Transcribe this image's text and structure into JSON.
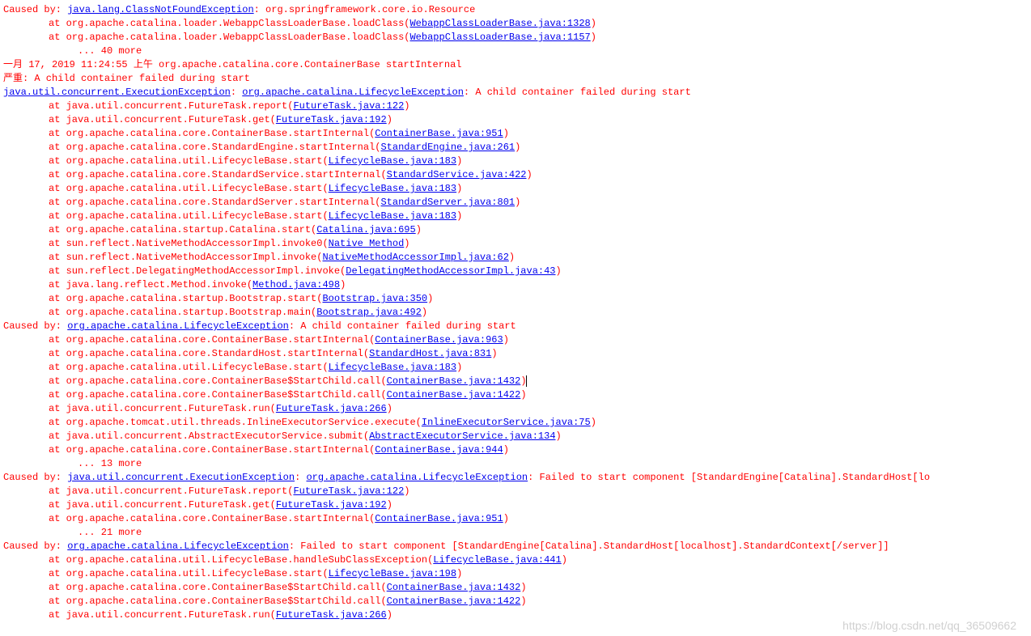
{
  "watermark": "https://blog.csdn.net/qq_36509662",
  "lines": [
    {
      "parts": [
        {
          "t": "Caused by: ",
          "c": "red"
        },
        {
          "t": "java.lang.ClassNotFoundException",
          "c": "blue"
        },
        {
          "t": ": org.springframework.core.io.Resource",
          "c": "red"
        }
      ]
    },
    {
      "indent": "at",
      "parts": [
        {
          "t": "at org.apache.catalina.loader.WebappClassLoaderBase.loadClass(",
          "c": "red"
        },
        {
          "t": "WebappClassLoaderBase.java:1328",
          "c": "blue"
        },
        {
          "t": ")",
          "c": "red"
        }
      ]
    },
    {
      "indent": "at",
      "parts": [
        {
          "t": "at org.apache.catalina.loader.WebappClassLoaderBase.loadClass(",
          "c": "red"
        },
        {
          "t": "WebappClassLoaderBase.java:1157",
          "c": "blue"
        },
        {
          "t": ")",
          "c": "red"
        }
      ]
    },
    {
      "indent": "more",
      "parts": [
        {
          "t": "... 40 more",
          "c": "red"
        }
      ]
    },
    {
      "parts": [
        {
          "t": " ",
          "c": "black"
        }
      ]
    },
    {
      "parts": [
        {
          "t": "一月 17, 2019 11:24:55 上午 org.apache.catalina.core.ContainerBase startInternal",
          "c": "red"
        }
      ]
    },
    {
      "parts": [
        {
          "t": "严重: A child container failed during start",
          "c": "red"
        }
      ]
    },
    {
      "parts": [
        {
          "t": "java.util.concurrent.ExecutionException",
          "c": "blue"
        },
        {
          "t": ": ",
          "c": "red"
        },
        {
          "t": "org.apache.catalina.LifecycleException",
          "c": "blue"
        },
        {
          "t": ": A child container failed during start",
          "c": "red"
        }
      ]
    },
    {
      "indent": "at",
      "parts": [
        {
          "t": "at java.util.concurrent.FutureTask.report(",
          "c": "red"
        },
        {
          "t": "FutureTask.java:122",
          "c": "blue"
        },
        {
          "t": ")",
          "c": "red"
        }
      ]
    },
    {
      "indent": "at",
      "parts": [
        {
          "t": "at java.util.concurrent.FutureTask.get(",
          "c": "red"
        },
        {
          "t": "FutureTask.java:192",
          "c": "blue"
        },
        {
          "t": ")",
          "c": "red"
        }
      ]
    },
    {
      "indent": "at",
      "parts": [
        {
          "t": "at org.apache.catalina.core.ContainerBase.startInternal(",
          "c": "red"
        },
        {
          "t": "ContainerBase.java:951",
          "c": "blue"
        },
        {
          "t": ")",
          "c": "red"
        }
      ]
    },
    {
      "indent": "at",
      "parts": [
        {
          "t": "at org.apache.catalina.core.StandardEngine.startInternal(",
          "c": "red"
        },
        {
          "t": "StandardEngine.java:261",
          "c": "blue"
        },
        {
          "t": ")",
          "c": "red"
        }
      ]
    },
    {
      "indent": "at",
      "parts": [
        {
          "t": "at org.apache.catalina.util.LifecycleBase.start(",
          "c": "red"
        },
        {
          "t": "LifecycleBase.java:183",
          "c": "blue"
        },
        {
          "t": ")",
          "c": "red"
        }
      ]
    },
    {
      "indent": "at",
      "parts": [
        {
          "t": "at org.apache.catalina.core.StandardService.startInternal(",
          "c": "red"
        },
        {
          "t": "StandardService.java:422",
          "c": "blue"
        },
        {
          "t": ")",
          "c": "red"
        }
      ]
    },
    {
      "indent": "at",
      "parts": [
        {
          "t": "at org.apache.catalina.util.LifecycleBase.start(",
          "c": "red"
        },
        {
          "t": "LifecycleBase.java:183",
          "c": "blue"
        },
        {
          "t": ")",
          "c": "red"
        }
      ]
    },
    {
      "indent": "at",
      "parts": [
        {
          "t": "at org.apache.catalina.core.StandardServer.startInternal(",
          "c": "red"
        },
        {
          "t": "StandardServer.java:801",
          "c": "blue"
        },
        {
          "t": ")",
          "c": "red"
        }
      ]
    },
    {
      "indent": "at",
      "parts": [
        {
          "t": "at org.apache.catalina.util.LifecycleBase.start(",
          "c": "red"
        },
        {
          "t": "LifecycleBase.java:183",
          "c": "blue"
        },
        {
          "t": ")",
          "c": "red"
        }
      ]
    },
    {
      "indent": "at",
      "parts": [
        {
          "t": "at org.apache.catalina.startup.Catalina.start(",
          "c": "red"
        },
        {
          "t": "Catalina.java:695",
          "c": "blue"
        },
        {
          "t": ")",
          "c": "red"
        }
      ]
    },
    {
      "indent": "at",
      "parts": [
        {
          "t": "at sun.reflect.NativeMethodAccessorImpl.invoke0(",
          "c": "red"
        },
        {
          "t": "Native Method",
          "c": "blue"
        },
        {
          "t": ")",
          "c": "red"
        }
      ]
    },
    {
      "indent": "at",
      "parts": [
        {
          "t": "at sun.reflect.NativeMethodAccessorImpl.invoke(",
          "c": "red"
        },
        {
          "t": "NativeMethodAccessorImpl.java:62",
          "c": "blue"
        },
        {
          "t": ")",
          "c": "red"
        }
      ]
    },
    {
      "indent": "at",
      "parts": [
        {
          "t": "at sun.reflect.DelegatingMethodAccessorImpl.invoke(",
          "c": "red"
        },
        {
          "t": "DelegatingMethodAccessorImpl.java:43",
          "c": "blue"
        },
        {
          "t": ")",
          "c": "red"
        }
      ]
    },
    {
      "indent": "at",
      "parts": [
        {
          "t": "at java.lang.reflect.Method.invoke(",
          "c": "red"
        },
        {
          "t": "Method.java:498",
          "c": "blue"
        },
        {
          "t": ")",
          "c": "red"
        }
      ]
    },
    {
      "indent": "at",
      "parts": [
        {
          "t": "at org.apache.catalina.startup.Bootstrap.start(",
          "c": "red"
        },
        {
          "t": "Bootstrap.java:350",
          "c": "blue"
        },
        {
          "t": ")",
          "c": "red"
        }
      ]
    },
    {
      "indent": "at",
      "parts": [
        {
          "t": "at org.apache.catalina.startup.Bootstrap.main(",
          "c": "red"
        },
        {
          "t": "Bootstrap.java:492",
          "c": "blue"
        },
        {
          "t": ")",
          "c": "red"
        }
      ]
    },
    {
      "parts": [
        {
          "t": "Caused by: ",
          "c": "red"
        },
        {
          "t": "org.apache.catalina.LifecycleException",
          "c": "blue"
        },
        {
          "t": ": A child container failed during start",
          "c": "red"
        }
      ]
    },
    {
      "indent": "at",
      "parts": [
        {
          "t": "at org.apache.catalina.core.ContainerBase.startInternal(",
          "c": "red"
        },
        {
          "t": "ContainerBase.java:963",
          "c": "blue"
        },
        {
          "t": ")",
          "c": "red"
        }
      ]
    },
    {
      "indent": "at",
      "parts": [
        {
          "t": "at org.apache.catalina.core.StandardHost.startInternal(",
          "c": "red"
        },
        {
          "t": "StandardHost.java:831",
          "c": "blue"
        },
        {
          "t": ")",
          "c": "red"
        }
      ]
    },
    {
      "indent": "at",
      "parts": [
        {
          "t": "at org.apache.catalina.util.LifecycleBase.start(",
          "c": "red"
        },
        {
          "t": "LifecycleBase.java:183",
          "c": "blue"
        },
        {
          "t": ")",
          "c": "red"
        }
      ]
    },
    {
      "indent": "at",
      "parts": [
        {
          "t": "at org.apache.catalina.core.ContainerBase$StartChild.call(",
          "c": "red"
        },
        {
          "t": "ContainerBase.java:1432",
          "c": "blue"
        },
        {
          "t": ")",
          "c": "red"
        },
        {
          "t": "",
          "cursor": true
        }
      ]
    },
    {
      "indent": "at",
      "parts": [
        {
          "t": "at org.apache.catalina.core.ContainerBase$StartChild.call(",
          "c": "red"
        },
        {
          "t": "ContainerBase.java:1422",
          "c": "blue"
        },
        {
          "t": ")",
          "c": "red"
        }
      ]
    },
    {
      "indent": "at",
      "parts": [
        {
          "t": "at java.util.concurrent.FutureTask.run(",
          "c": "red"
        },
        {
          "t": "FutureTask.java:266",
          "c": "blue"
        },
        {
          "t": ")",
          "c": "red"
        }
      ]
    },
    {
      "indent": "at",
      "parts": [
        {
          "t": "at org.apache.tomcat.util.threads.InlineExecutorService.execute(",
          "c": "red"
        },
        {
          "t": "InlineExecutorService.java:75",
          "c": "blue"
        },
        {
          "t": ")",
          "c": "red"
        }
      ]
    },
    {
      "indent": "at",
      "parts": [
        {
          "t": "at java.util.concurrent.AbstractExecutorService.submit(",
          "c": "red"
        },
        {
          "t": "AbstractExecutorService.java:134",
          "c": "blue"
        },
        {
          "t": ")",
          "c": "red"
        }
      ]
    },
    {
      "indent": "at",
      "parts": [
        {
          "t": "at org.apache.catalina.core.ContainerBase.startInternal(",
          "c": "red"
        },
        {
          "t": "ContainerBase.java:944",
          "c": "blue"
        },
        {
          "t": ")",
          "c": "red"
        }
      ]
    },
    {
      "indent": "more",
      "parts": [
        {
          "t": "... 13 more",
          "c": "red"
        }
      ]
    },
    {
      "parts": [
        {
          "t": "Caused by: ",
          "c": "red"
        },
        {
          "t": "java.util.concurrent.ExecutionException",
          "c": "blue"
        },
        {
          "t": ": ",
          "c": "red"
        },
        {
          "t": "org.apache.catalina.LifecycleException",
          "c": "blue"
        },
        {
          "t": ": Failed to start component [StandardEngine[Catalina].StandardHost[lo",
          "c": "red"
        }
      ]
    },
    {
      "indent": "at",
      "parts": [
        {
          "t": "at java.util.concurrent.FutureTask.report(",
          "c": "red"
        },
        {
          "t": "FutureTask.java:122",
          "c": "blue"
        },
        {
          "t": ")",
          "c": "red"
        }
      ]
    },
    {
      "indent": "at",
      "parts": [
        {
          "t": "at java.util.concurrent.FutureTask.get(",
          "c": "red"
        },
        {
          "t": "FutureTask.java:192",
          "c": "blue"
        },
        {
          "t": ")",
          "c": "red"
        }
      ]
    },
    {
      "indent": "at",
      "parts": [
        {
          "t": "at org.apache.catalina.core.ContainerBase.startInternal(",
          "c": "red"
        },
        {
          "t": "ContainerBase.java:951",
          "c": "blue"
        },
        {
          "t": ")",
          "c": "red"
        }
      ]
    },
    {
      "indent": "more",
      "parts": [
        {
          "t": "... 21 more",
          "c": "red"
        }
      ]
    },
    {
      "parts": [
        {
          "t": "Caused by: ",
          "c": "red"
        },
        {
          "t": "org.apache.catalina.LifecycleException",
          "c": "blue"
        },
        {
          "t": ": Failed to start component [StandardEngine[Catalina].StandardHost[localhost].StandardContext[/server]]",
          "c": "red"
        }
      ]
    },
    {
      "indent": "at",
      "parts": [
        {
          "t": "at org.apache.catalina.util.LifecycleBase.handleSubClassException(",
          "c": "red"
        },
        {
          "t": "LifecycleBase.java:441",
          "c": "blue"
        },
        {
          "t": ")",
          "c": "red"
        }
      ]
    },
    {
      "indent": "at",
      "parts": [
        {
          "t": "at org.apache.catalina.util.LifecycleBase.start(",
          "c": "red"
        },
        {
          "t": "LifecycleBase.java:198",
          "c": "blue"
        },
        {
          "t": ")",
          "c": "red"
        }
      ]
    },
    {
      "indent": "at",
      "parts": [
        {
          "t": "at org.apache.catalina.core.ContainerBase$StartChild.call(",
          "c": "red"
        },
        {
          "t": "ContainerBase.java:1432",
          "c": "blue"
        },
        {
          "t": ")",
          "c": "red"
        }
      ]
    },
    {
      "indent": "at",
      "parts": [
        {
          "t": "at org.apache.catalina.core.ContainerBase$StartChild.call(",
          "c": "red"
        },
        {
          "t": "ContainerBase.java:1422",
          "c": "blue"
        },
        {
          "t": ")",
          "c": "red"
        }
      ]
    },
    {
      "indent": "at",
      "parts": [
        {
          "t": "at java.util.concurrent.FutureTask.run(",
          "c": "red"
        },
        {
          "t": "FutureTask.java:266",
          "c": "blue"
        },
        {
          "t": ")",
          "c": "red"
        }
      ]
    }
  ]
}
